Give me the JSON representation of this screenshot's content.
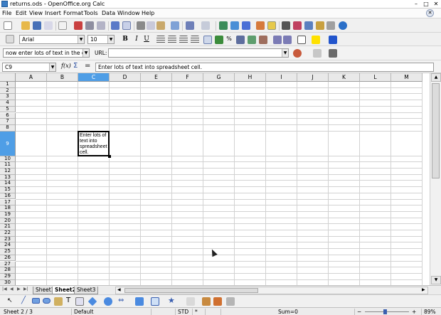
{
  "window": {
    "title": "returns.ods - OpenOffice.org Calc",
    "min": "–",
    "max": "□",
    "close": "✕"
  },
  "menu": [
    "File",
    "Edit",
    "View",
    "Insert",
    "Format",
    "Tools",
    "Data",
    "Window",
    "Help"
  ],
  "toolbar_format": {
    "style_value": "",
    "font_name": "Arial",
    "font_size": "10",
    "bold": "B",
    "italic": "I",
    "underline": "U",
    "percent": "%"
  },
  "hyperlink_bar": {
    "text_value": "now enter lots of text in the cell wi",
    "url_label": "URL:",
    "url_value": ""
  },
  "formula_bar": {
    "name_box": "C9",
    "func_icon": "f(x)",
    "sum_icon": "Σ",
    "equals_icon": "=",
    "content": "Enter lots of text into spreadsheet cell."
  },
  "grid": {
    "columns": [
      "A",
      "B",
      "C",
      "D",
      "E",
      "F",
      "G",
      "H",
      "I",
      "J",
      "K",
      "L",
      "M"
    ],
    "selected_column": "C",
    "rows": [
      "1",
      "2",
      "3",
      "4",
      "5",
      "6",
      "7",
      "8",
      "9",
      "10",
      "11",
      "12",
      "13",
      "14",
      "15",
      "16",
      "17",
      "18",
      "19",
      "20",
      "21",
      "22",
      "23",
      "24",
      "25",
      "26",
      "27",
      "28",
      "29",
      "30"
    ],
    "selected_row": "9",
    "active_cell_text": "Enter lots of text into spreadsheet cell."
  },
  "sheets": {
    "tabs": [
      "Sheet1",
      "Sheet2",
      "Sheet3"
    ],
    "active": "Sheet2"
  },
  "status": {
    "sheet": "Sheet 2 / 3",
    "page_style": "Default",
    "mode": "STD",
    "marker": "*",
    "sum": "Sum=0",
    "zoom": "89%",
    "zoom_minus": "−",
    "zoom_plus": "+"
  },
  "colors": {
    "selection_header": "#4f9ee6",
    "grid_line": "#d2d2d2",
    "header_bg": "#e9e9e9"
  }
}
